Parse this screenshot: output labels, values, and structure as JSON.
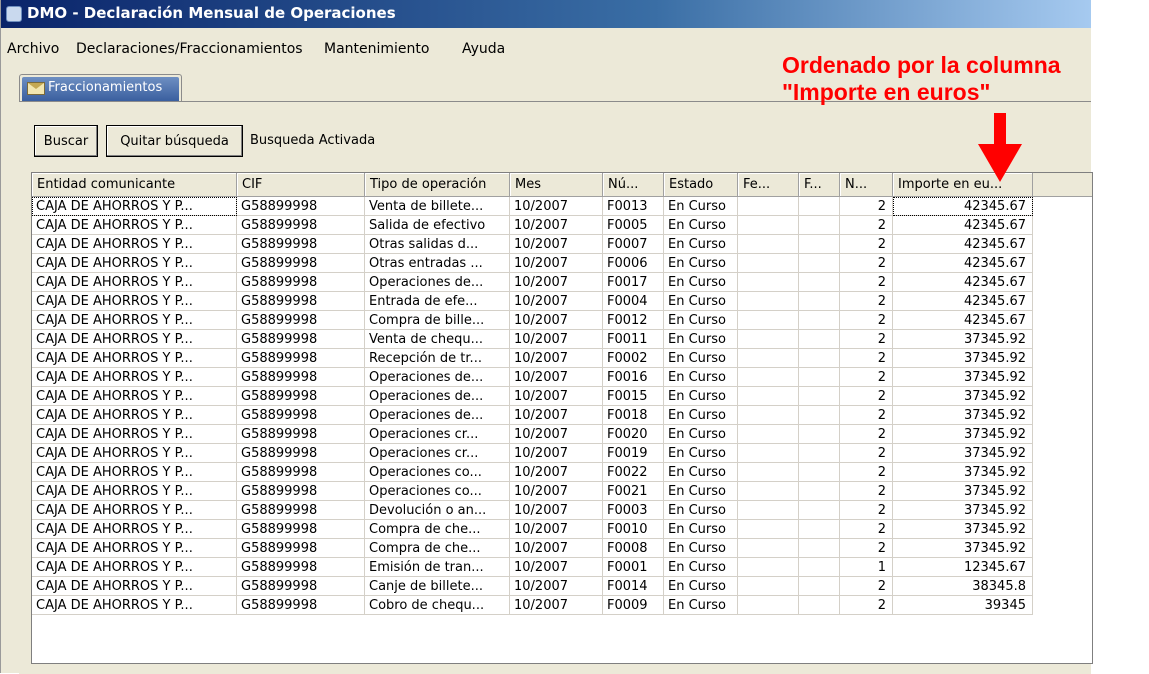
{
  "window": {
    "title": "DMO - Declaración Mensual de Operaciones"
  },
  "menu": [
    "Archivo",
    "Declaraciones/Fraccionamientos",
    "Mantenimiento",
    "Ayuda"
  ],
  "tab": {
    "label": "Fraccionamientos",
    "icon": "envelope-icon"
  },
  "toolbar": {
    "search_label": "Buscar",
    "clear_label": "Quitar búsqueda",
    "status": "Busqueda Activada"
  },
  "annotation": {
    "line1": "Ordenado por la columna",
    "line2": "\"Importe en euros\"",
    "color": "#ff0000"
  },
  "table": {
    "columns": [
      "Entidad comunicante",
      "CIF",
      "Tipo de operación",
      "Mes",
      "Nú...",
      "Estado",
      "Fe...",
      "F...",
      "N...",
      "Importe en eu..."
    ],
    "rows": [
      [
        "CAJA DE AHORROS Y P...",
        "G58899998",
        "Venta de billete...",
        "10/2007",
        "F0013",
        "En Curso",
        "",
        "",
        "2",
        "42345.67"
      ],
      [
        "CAJA DE AHORROS Y P...",
        "G58899998",
        "Salida de efectivo",
        "10/2007",
        "F0005",
        "En Curso",
        "",
        "",
        "2",
        "42345.67"
      ],
      [
        "CAJA DE AHORROS Y P...",
        "G58899998",
        "Otras salidas d...",
        "10/2007",
        "F0007",
        "En Curso",
        "",
        "",
        "2",
        "42345.67"
      ],
      [
        "CAJA DE AHORROS Y P...",
        "G58899998",
        "Otras entradas ...",
        "10/2007",
        "F0006",
        "En Curso",
        "",
        "",
        "2",
        "42345.67"
      ],
      [
        "CAJA DE AHORROS Y P...",
        "G58899998",
        "Operaciones de...",
        "10/2007",
        "F0017",
        "En Curso",
        "",
        "",
        "2",
        "42345.67"
      ],
      [
        "CAJA DE AHORROS Y P...",
        "G58899998",
        "Entrada de efe...",
        "10/2007",
        "F0004",
        "En Curso",
        "",
        "",
        "2",
        "42345.67"
      ],
      [
        "CAJA DE AHORROS Y P...",
        "G58899998",
        "Compra de bille...",
        "10/2007",
        "F0012",
        "En Curso",
        "",
        "",
        "2",
        "42345.67"
      ],
      [
        "CAJA DE AHORROS Y P...",
        "G58899998",
        "Venta de chequ...",
        "10/2007",
        "F0011",
        "En Curso",
        "",
        "",
        "2",
        "37345.92"
      ],
      [
        "CAJA DE AHORROS Y P...",
        "G58899998",
        "Recepción de tr...",
        "10/2007",
        "F0002",
        "En Curso",
        "",
        "",
        "2",
        "37345.92"
      ],
      [
        "CAJA DE AHORROS Y P...",
        "G58899998",
        "Operaciones de...",
        "10/2007",
        "F0016",
        "En Curso",
        "",
        "",
        "2",
        "37345.92"
      ],
      [
        "CAJA DE AHORROS Y P...",
        "G58899998",
        "Operaciones de...",
        "10/2007",
        "F0015",
        "En Curso",
        "",
        "",
        "2",
        "37345.92"
      ],
      [
        "CAJA DE AHORROS Y P...",
        "G58899998",
        "Operaciones de...",
        "10/2007",
        "F0018",
        "En Curso",
        "",
        "",
        "2",
        "37345.92"
      ],
      [
        "CAJA DE AHORROS Y P...",
        "G58899998",
        "Operaciones cr...",
        "10/2007",
        "F0020",
        "En Curso",
        "",
        "",
        "2",
        "37345.92"
      ],
      [
        "CAJA DE AHORROS Y P...",
        "G58899998",
        "Operaciones cr...",
        "10/2007",
        "F0019",
        "En Curso",
        "",
        "",
        "2",
        "37345.92"
      ],
      [
        "CAJA DE AHORROS Y P...",
        "G58899998",
        "Operaciones co...",
        "10/2007",
        "F0022",
        "En Curso",
        "",
        "",
        "2",
        "37345.92"
      ],
      [
        "CAJA DE AHORROS Y P...",
        "G58899998",
        "Operaciones co...",
        "10/2007",
        "F0021",
        "En Curso",
        "",
        "",
        "2",
        "37345.92"
      ],
      [
        "CAJA DE AHORROS Y P...",
        "G58899998",
        "Devolución o an...",
        "10/2007",
        "F0003",
        "En Curso",
        "",
        "",
        "2",
        "37345.92"
      ],
      [
        "CAJA DE AHORROS Y P...",
        "G58899998",
        "Compra de che...",
        "10/2007",
        "F0010",
        "En Curso",
        "",
        "",
        "2",
        "37345.92"
      ],
      [
        "CAJA DE AHORROS Y P...",
        "G58899998",
        "Compra de che...",
        "10/2007",
        "F0008",
        "En Curso",
        "",
        "",
        "2",
        "37345.92"
      ],
      [
        "CAJA DE AHORROS Y P...",
        "G58899998",
        "Emisión de tran...",
        "10/2007",
        "F0001",
        "En Curso",
        "",
        "",
        "1",
        "12345.67"
      ],
      [
        "CAJA DE AHORROS Y P...",
        "G58899998",
        "Canje de billete...",
        "10/2007",
        "F0014",
        "En Curso",
        "",
        "",
        "2",
        "38345.8"
      ],
      [
        "CAJA DE AHORROS Y P...",
        "G58899998",
        "Cobro de chequ...",
        "10/2007",
        "F0009",
        "En Curso",
        "",
        "",
        "2",
        "39345"
      ]
    ]
  }
}
